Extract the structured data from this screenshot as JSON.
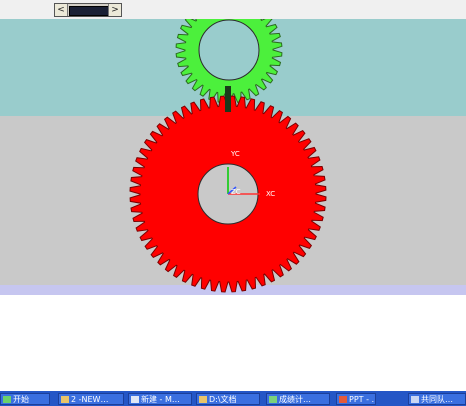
{
  "scrollbar": {
    "left_arrow": "<",
    "right_arrow": ">"
  },
  "axes": {
    "yc": "YC",
    "xc": "XC",
    "zc": "ZC"
  },
  "colors": {
    "viewport_top": "#99cccc",
    "viewport_bottom": "#c9c9c9",
    "small_gear": "#4cf03c",
    "large_gear": "#ff0000",
    "taskbar": "#2456c6"
  },
  "gears": [
    {
      "name": "small gear",
      "color": "#4cf03c",
      "teeth": 34
    },
    {
      "name": "large gear",
      "color": "#ff0000",
      "teeth": 60
    }
  ],
  "taskbar": {
    "start": "开始",
    "items": [
      "2 -NEW…",
      "新建 - M…",
      "D:\\文档",
      "成绩计…",
      "PPT - …",
      "共同队…"
    ]
  }
}
